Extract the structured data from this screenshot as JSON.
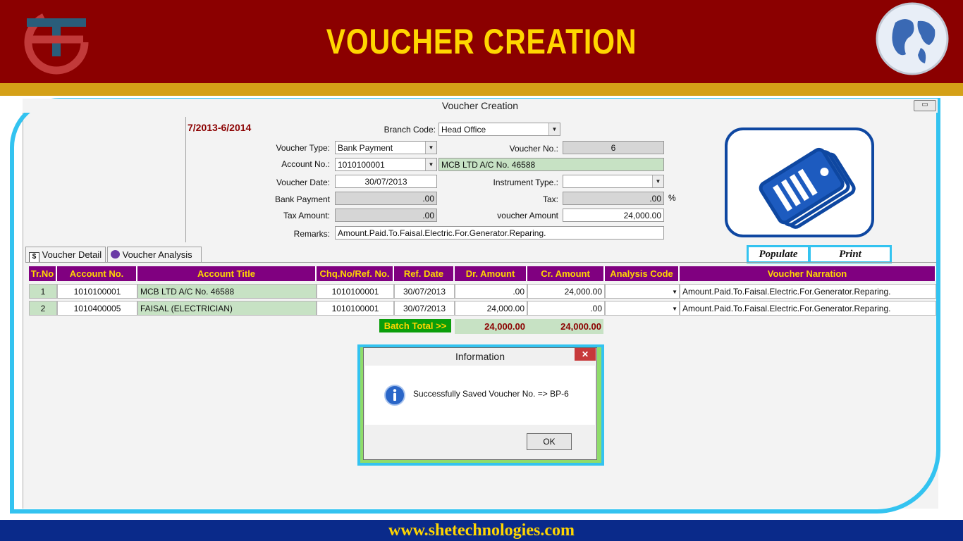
{
  "banner": {
    "title": "VOUCHER CREATION"
  },
  "footer": {
    "url": "www.shetechnologies.com"
  },
  "window": {
    "title": "Voucher Creation",
    "minimize": "▭"
  },
  "form": {
    "fiscal_year": "7/2013-6/2014",
    "branch_code_label": "Branch Code:",
    "branch_code": "Head Office",
    "voucher_type_label": "Voucher Type:",
    "voucher_type": "Bank Payment",
    "voucher_no_label": "Voucher No.:",
    "voucher_no": "6",
    "account_no_label": "Account No.:",
    "account_no": "1010100001",
    "account_title": "MCB LTD  A/C No. 46588",
    "voucher_date_label": "Voucher Date:",
    "voucher_date": "30/07/2013",
    "instrument_type_label": "Instrument Type.:",
    "instrument_type": "",
    "bank_payment_label": "Bank Payment",
    "bank_payment": ".00",
    "tax_label": "Tax:",
    "tax": ".00",
    "tax_unit": "%",
    "tax_amount_label": "Tax Amount:",
    "tax_amount": ".00",
    "voucher_amount_label": "voucher Amount",
    "voucher_amount": "24,000.00",
    "remarks_label": "Remarks:",
    "remarks": "Amount.Paid.To.Faisal.Electric.For.Generator.Reparing."
  },
  "actions": {
    "populate": "Populate",
    "print": "Print"
  },
  "tabs": [
    {
      "label": "Voucher Detail",
      "icon": "dollar-icon"
    },
    {
      "label": "Voucher Analysis",
      "icon": "analysis-icon"
    }
  ],
  "table": {
    "headers": [
      "Tr.No",
      "Account No.",
      "Account Title",
      "Chq.No/Ref. No.",
      "Ref. Date",
      "Dr. Amount",
      "Cr. Amount",
      "Analysis Code",
      "Voucher Narration"
    ],
    "rows": [
      {
        "tr": "1",
        "account": "1010100001",
        "title": "MCB LTD  A/C No. 46588",
        "chq": "1010100001",
        "date": "30/07/2013",
        "dr": ".00",
        "cr": "24,000.00",
        "analysis": "",
        "narration": "Amount.Paid.To.Faisal.Electric.For.Generator.Reparing."
      },
      {
        "tr": "2",
        "account": "1010400005",
        "title": "FAISAL (ELECTRICIAN)",
        "chq": "1010100001",
        "date": "30/07/2013",
        "dr": "24,000.00",
        "cr": ".00",
        "analysis": "",
        "narration": "Amount.Paid.To.Faisal.Electric.For.Generator.Reparing."
      }
    ],
    "batch_label": "Batch Total  >>",
    "batch_dr": "24,000.00",
    "batch_cr": "24,000.00"
  },
  "dialog": {
    "title": "Information",
    "close": "✕",
    "message": "Successfully Saved Voucher No. => BP-6",
    "ok": "OK"
  },
  "colors": {
    "banner": "#8b0000",
    "title": "#ffd600",
    "frame": "#33c3f0",
    "header": "#800080",
    "green_field": "#c7e2c4"
  }
}
